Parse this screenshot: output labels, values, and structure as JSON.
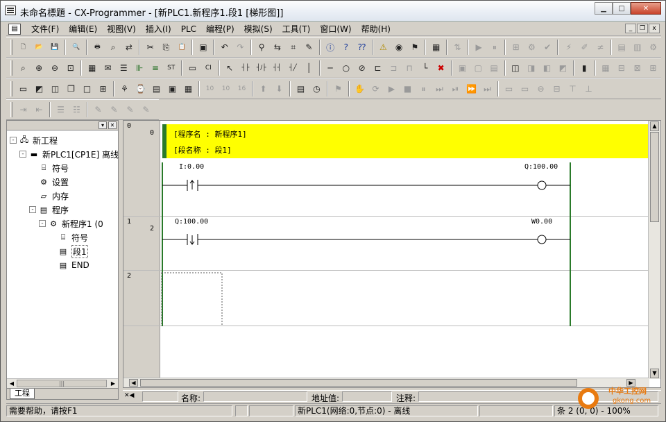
{
  "window": {
    "title": "未命名標題 - CX-Programmer - [新PLC1.新程序1.段1 [梯形图]]",
    "caption_buttons": {
      "minimize": "▁",
      "maximize": "□",
      "close": "✕"
    }
  },
  "menubar": {
    "items": [
      "文件(F)",
      "编辑(E)",
      "视图(V)",
      "插入(I)",
      "PLC",
      "编程(P)",
      "模拟(S)",
      "工具(T)",
      "窗口(W)",
      "帮助(H)"
    ],
    "mdi_buttons": {
      "minimize": "_",
      "restore": "❐",
      "close": "x"
    }
  },
  "toolbars": {
    "row1": [
      "new-file-icon",
      "open-folder-icon",
      "save-icon",
      "|",
      "print-preview-icon",
      "|",
      "print-icon",
      "find-icon",
      "replace-icon",
      "|",
      "cut-icon",
      "copy-icon",
      "paste-icon",
      "|",
      "clipboard-icon",
      "|",
      "undo-icon",
      "redo-icon",
      "|",
      "binoculars-icon",
      "cross-ref-icon",
      "address-icon",
      "rename-icon",
      "|",
      "info-icon",
      "help-icon",
      "context-help-icon",
      "|",
      "warning-icon",
      "monitor-icon",
      "online-icon",
      "|",
      "program-icon",
      "|",
      "transfer-icon",
      "|",
      "run-icon",
      "pause-icon",
      "|",
      "compare-icon",
      "compile-icon",
      "check-icon",
      "|",
      "connect-icon",
      "online-edit-icon",
      "diff-icon",
      "|",
      "memory-icon",
      "io-table-icon",
      "settings-icon"
    ],
    "row2": [
      "zoom-icon",
      "zoom-in-icon",
      "zoom-out-icon",
      "zoom-fit-icon",
      "|",
      "grid-icon",
      "comment-icon",
      "list-icon",
      "ladder-icon",
      "mnemonics-icon",
      "st-icon",
      "|",
      "spm-icon",
      "cti-icon",
      "|",
      "select-pointer-icon",
      "contact-no-icon",
      "contact-nc-icon",
      "or-no-icon",
      "or-nc-icon",
      "vertical-line-icon",
      "|",
      "horizontal-line-icon",
      "coil-icon",
      "coil-nc-icon",
      "instruction-icon",
      "pulse-icon",
      "up-diff-icon",
      "line-connect-icon",
      "delete-icon",
      "|",
      "monitor-on-icon",
      "monitor-off-icon",
      "io-comment-icon",
      "|",
      "bit-icon",
      "counter-icon",
      "timer-icon",
      "data-icon",
      "|",
      "trace-icon",
      "|",
      "task-icon",
      "io-icon",
      "symbol-icon",
      "stack-icon"
    ],
    "row3": [
      "window-icon",
      "arrange-icon",
      "tile-icon",
      "cascade-icon",
      "maximize-icon",
      "properties-icon",
      "|",
      "project-icon",
      "watch-icon",
      "output-icon",
      "address-ref-icon",
      "panel-icon",
      "|",
      "hex10-icon",
      "hex10b-icon",
      "hex16-icon",
      "|",
      "upload-icon",
      "download-icon",
      "|",
      "memory-card-icon",
      "clock-icon",
      "|",
      "force-icon",
      "|",
      "hand-icon",
      "step-icon",
      "play-icon",
      "stop-icon",
      "pause2-icon",
      "step-forward-icon",
      "step-run-icon",
      "fast-forward-icon",
      "step-end-icon",
      "|",
      "bar1-icon",
      "bar2-icon",
      "bar3-icon",
      "bar4-icon",
      "bar5-icon",
      "bar6-icon"
    ],
    "row4": [
      "indent-icon",
      "outdent-icon",
      "|",
      "list-indent-icon",
      "list-outdent-icon",
      "|",
      "pencil-icon",
      "pencil-x-icon",
      "pencil-check-icon",
      "pencil-edit-icon"
    ]
  },
  "project_tree": {
    "nodes": [
      {
        "label": "新工程",
        "level": 0,
        "toggle": "-",
        "icon": "network-icon"
      },
      {
        "label": "新PLC1[CP1E] 离线",
        "level": 1,
        "toggle": "-",
        "icon": "plc-icon"
      },
      {
        "label": "符号",
        "level": 2,
        "toggle": "",
        "icon": "symbols-icon"
      },
      {
        "label": "设置",
        "level": 2,
        "toggle": "",
        "icon": "settings-icon"
      },
      {
        "label": "内存",
        "level": 2,
        "toggle": "",
        "icon": "memory-icon"
      },
      {
        "label": "程序",
        "level": 2,
        "toggle": "-",
        "icon": "programs-icon"
      },
      {
        "label": "新程序1 (0",
        "level": 3,
        "toggle": "-",
        "icon": "program-icon"
      },
      {
        "label": "符号",
        "level": 4,
        "toggle": "",
        "icon": "symbols-icon"
      },
      {
        "label": "段1",
        "level": 4,
        "toggle": "",
        "icon": "section-icon",
        "selected": true
      },
      {
        "label": "END",
        "level": 4,
        "toggle": "",
        "icon": "section-icon"
      }
    ],
    "tab_label": "工程"
  },
  "ladder": {
    "program_header": {
      "program_name": "[程序名 : 新程序1]",
      "section_name": "[段名称 : 段1]"
    },
    "rungs": [
      {
        "number": "0",
        "step": "0",
        "header": true,
        "contact_address": "I:0.00",
        "contact_type": "up",
        "coil_address": "Q:100.00"
      },
      {
        "number": "1",
        "step": "2",
        "contact_address": "Q:100.00",
        "contact_type": "down",
        "coil_address": "W0.00"
      },
      {
        "number": "2",
        "step": "",
        "empty": true
      }
    ]
  },
  "infobar": {
    "name_label": "名称:",
    "address_label": "地址值:",
    "comment_label": "注释:"
  },
  "status": {
    "help": "需要帮助，请按F1",
    "plc_info": "新PLC1(网络:0,节点:0) - 离线",
    "position": "条 2 (0, 0) - 100%"
  },
  "watermark": {
    "text": "中华工控网",
    "url": "gkong.com"
  },
  "colors": {
    "header_yellow": "#ffff00",
    "rail_green": "#2a7a2a",
    "accent_orange": "#e87a10"
  }
}
